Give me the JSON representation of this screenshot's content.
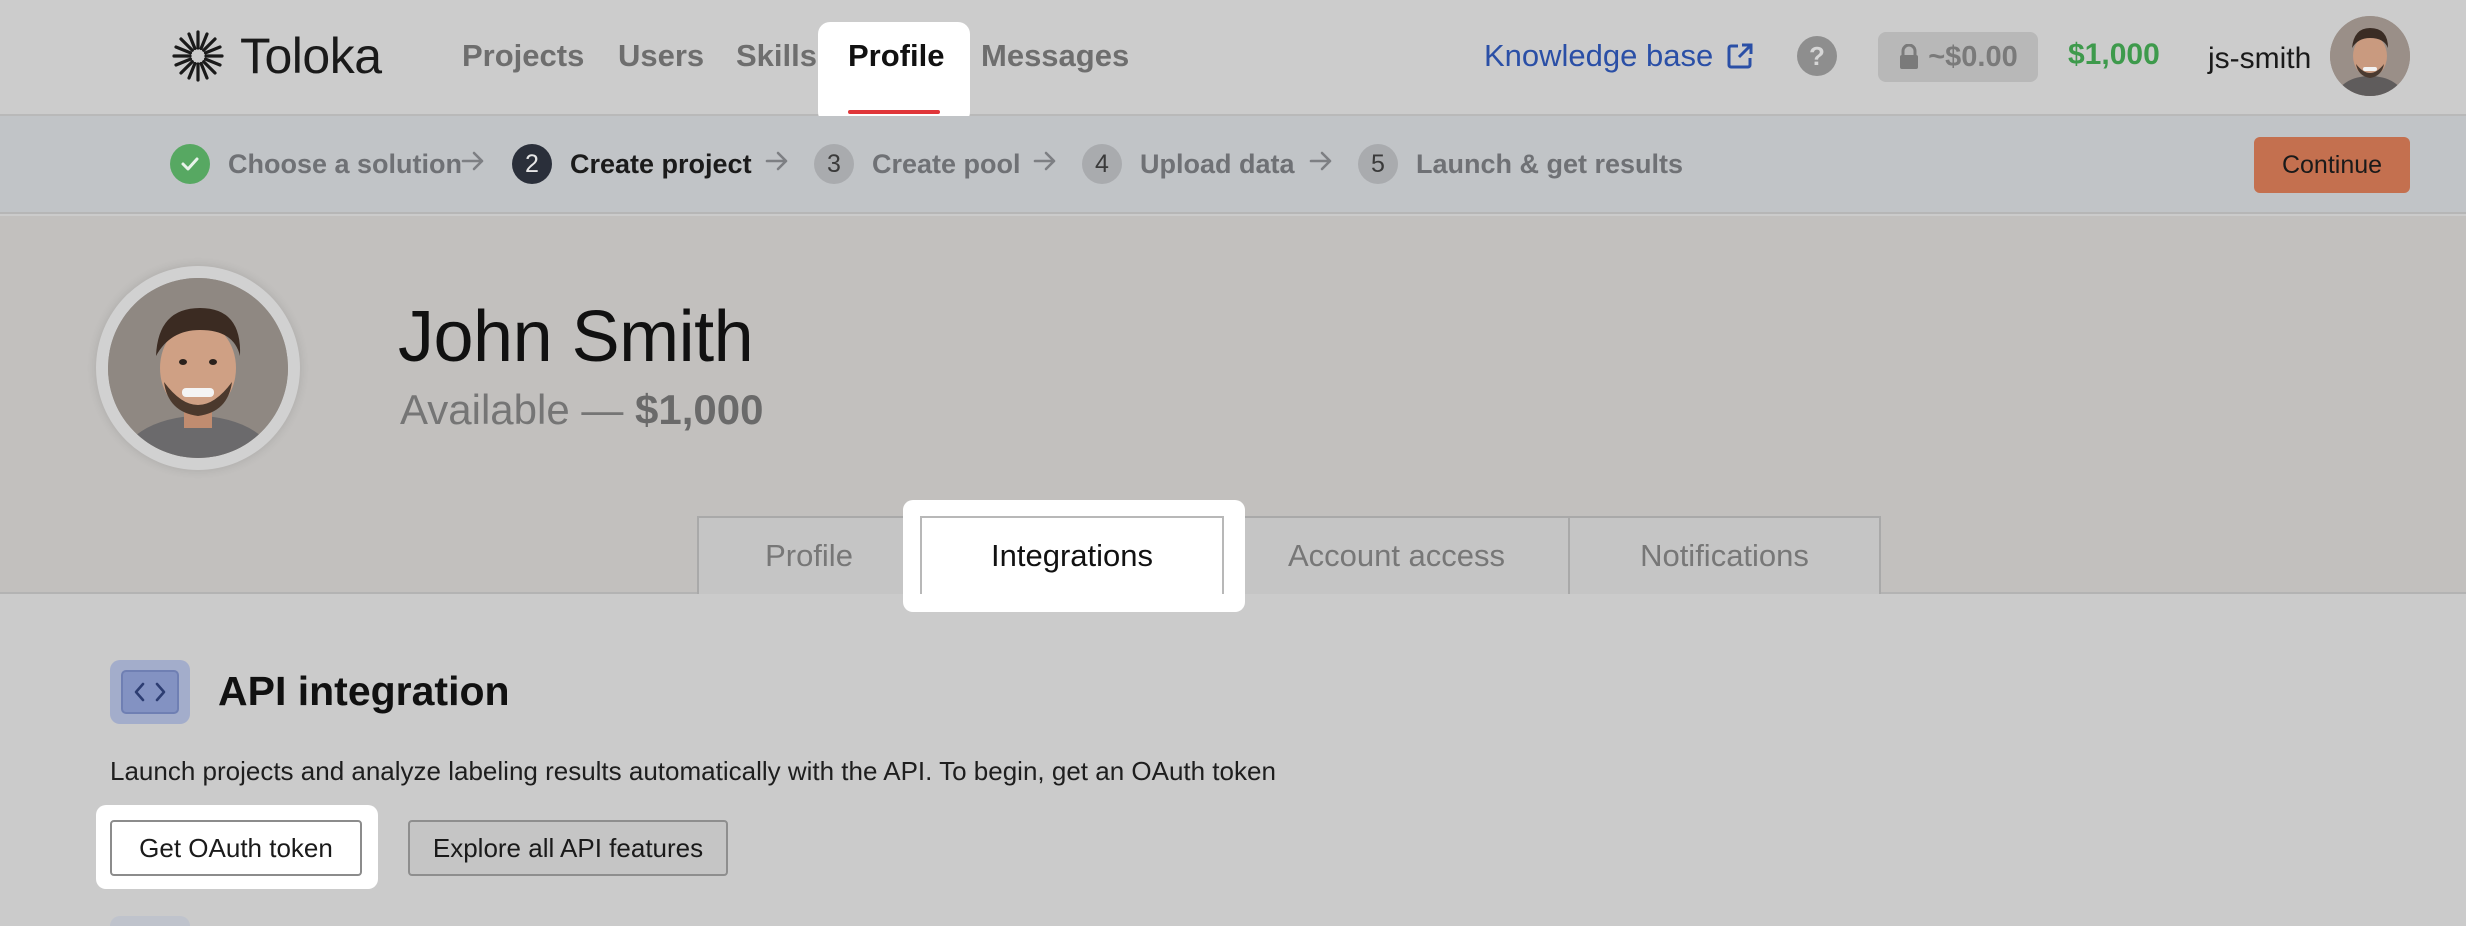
{
  "brand": {
    "name": "Toloka"
  },
  "nav": {
    "items": [
      {
        "label": "Projects"
      },
      {
        "label": "Users"
      },
      {
        "label": "Skills"
      },
      {
        "label": "Profile",
        "active": true
      },
      {
        "label": "Messages"
      }
    ],
    "knowledge_base": "Knowledge base",
    "help": "?",
    "locked_balance": "~$0.00",
    "balance": "$1,000",
    "username": "js-smith"
  },
  "stepper": {
    "steps": [
      {
        "number": "",
        "label": "Choose a solution",
        "state": "done"
      },
      {
        "number": "2",
        "label": "Create project",
        "state": "current"
      },
      {
        "number": "3",
        "label": "Create pool",
        "state": "todo"
      },
      {
        "number": "4",
        "label": "Upload data",
        "state": "todo"
      },
      {
        "number": "5",
        "label": "Launch & get results",
        "state": "todo"
      }
    ],
    "continue_label": "Continue"
  },
  "profile": {
    "name": "John Smith",
    "available_prefix": "Available —",
    "available_amount": "$1,000"
  },
  "tabs": [
    {
      "label": "Profile"
    },
    {
      "label": "Integrations",
      "active": true
    },
    {
      "label": "Account access"
    },
    {
      "label": "Notifications"
    }
  ],
  "api": {
    "title": "API integration",
    "description": "Launch projects and analyze labeling results automatically with the API. To begin, get an OAuth token",
    "oauth_button": "Get OAuth token",
    "explore_button": "Explore all API features"
  },
  "colors": {
    "accent_red": "#e0363a",
    "balance_green": "#3e9a4c",
    "link_blue": "#2a4fa6",
    "continue_orange": "#c4704f"
  }
}
